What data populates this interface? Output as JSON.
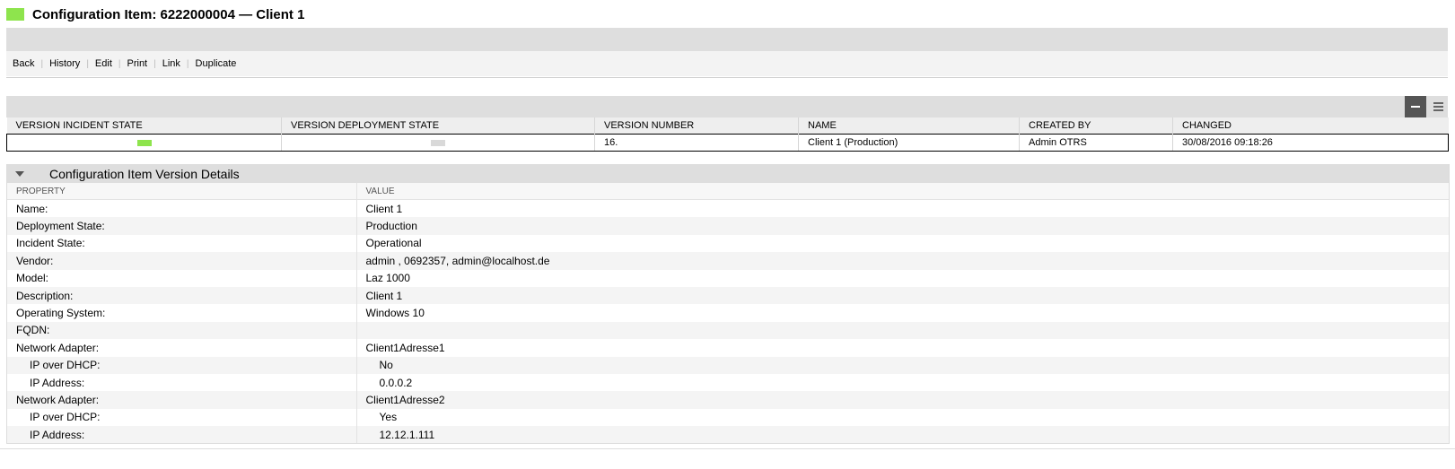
{
  "header": {
    "title": "Configuration Item: 6222000004  —  Client 1",
    "status_color": "#8ee44d"
  },
  "actions": [
    "Back",
    "History",
    "Edit",
    "Print",
    "Link",
    "Duplicate"
  ],
  "versions": {
    "columns": [
      "VERSION INCIDENT STATE",
      "VERSION DEPLOYMENT STATE",
      "VERSION NUMBER",
      "NAME",
      "CREATED BY",
      "CHANGED"
    ],
    "row": {
      "incident_color": "#8ee44d",
      "deployment_color": "#d9d9d9",
      "number": "16.",
      "name": "Client 1 (Production)",
      "created_by": "Admin OTRS",
      "changed": "30/08/2016 09:18:26"
    },
    "controls": [
      "minus-icon",
      "menu-icon"
    ]
  },
  "details": {
    "title": "Configuration Item Version Details",
    "headers": [
      "PROPERTY",
      "VALUE"
    ],
    "rows": [
      {
        "property": "Name:",
        "value": "Client 1"
      },
      {
        "property": "Deployment State:",
        "value": "Production"
      },
      {
        "property": "Incident State:",
        "value": "Operational"
      },
      {
        "property": "Vendor:",
        "value": "admin , 0692357, admin@localhost.de"
      },
      {
        "property": "Model:",
        "value": "Laz 1000"
      },
      {
        "property": "Description:",
        "value": "Client 1"
      },
      {
        "property": "Operating System:",
        "value": "Windows 10"
      },
      {
        "property": "FQDN:",
        "value": ""
      },
      {
        "property": "Network Adapter:",
        "value": "Client1Adresse1"
      },
      {
        "property": "IP over DHCP:",
        "value": "No"
      },
      {
        "property": "IP Address:",
        "value": "0.0.0.2"
      },
      {
        "property": "Network Adapter:",
        "value": "Client1Adresse2"
      },
      {
        "property": "IP over DHCP:",
        "value": "Yes"
      },
      {
        "property": "IP Address:",
        "value": "12.12.1.111"
      }
    ]
  }
}
